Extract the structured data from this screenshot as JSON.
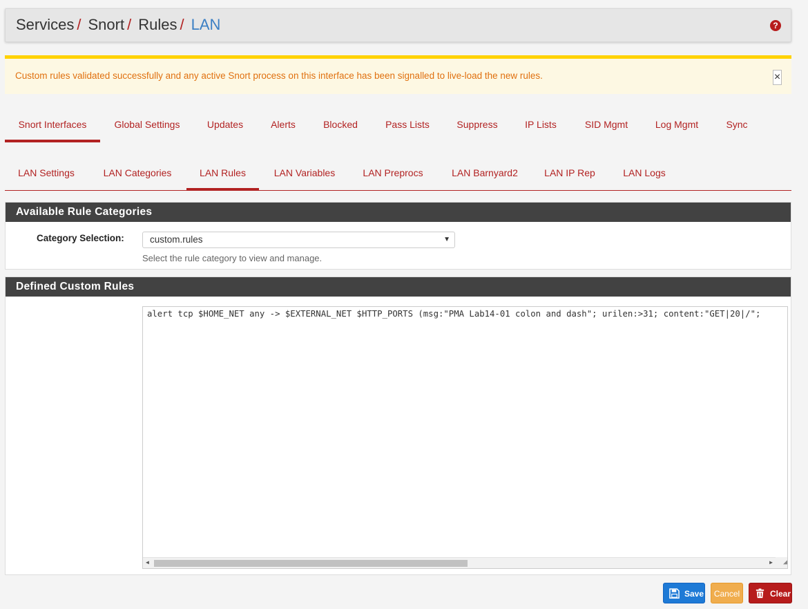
{
  "breadcrumb": {
    "items": [
      "Services",
      "Snort",
      "Rules"
    ],
    "current": "LAN",
    "separator": "/"
  },
  "help_icon": "question-circle-icon",
  "alert": {
    "message": "Custom rules validated successfully and any active Snort process on this interface has been signalled to live-load the new rules.",
    "close_label": "×"
  },
  "primary_tabs": [
    {
      "label": "Snort Interfaces",
      "active": true
    },
    {
      "label": "Global Settings"
    },
    {
      "label": "Updates"
    },
    {
      "label": "Alerts"
    },
    {
      "label": "Blocked"
    },
    {
      "label": "Pass Lists"
    },
    {
      "label": "Suppress"
    },
    {
      "label": "IP Lists"
    },
    {
      "label": "SID Mgmt"
    },
    {
      "label": "Log Mgmt"
    },
    {
      "label": "Sync"
    }
  ],
  "secondary_tabs": [
    {
      "label": "LAN Settings"
    },
    {
      "label": "LAN Categories"
    },
    {
      "label": "LAN Rules",
      "active": true
    },
    {
      "label": "LAN Variables"
    },
    {
      "label": "LAN Preprocs"
    },
    {
      "label": "LAN Barnyard2"
    },
    {
      "label": "LAN IP Rep"
    },
    {
      "label": "LAN Logs"
    }
  ],
  "categories_panel": {
    "title": "Available Rule Categories",
    "label": "Category Selection:",
    "selected": "custom.rules",
    "help": "Select the rule category to view and manage."
  },
  "custom_rules_panel": {
    "title": "Defined Custom Rules",
    "content": "alert tcp $HOME_NET any -> $EXTERNAL_NET $HTTP_PORTS (msg:\"PMA Lab14-01 colon and dash\"; urilen:>31; content:\"GET|20|/\";"
  },
  "buttons": {
    "save": "Save",
    "cancel": "Cancel",
    "clear": "Clear"
  },
  "colors": {
    "accent": "#b22222",
    "link_blue": "#3b7fc4",
    "alert_text": "#e0700f",
    "alert_border": "#ffd200",
    "panel_header": "#424242",
    "save_btn": "#1e7ad6",
    "cancel_btn": "#f0ad4e",
    "clear_btn": "#b71c1c"
  }
}
